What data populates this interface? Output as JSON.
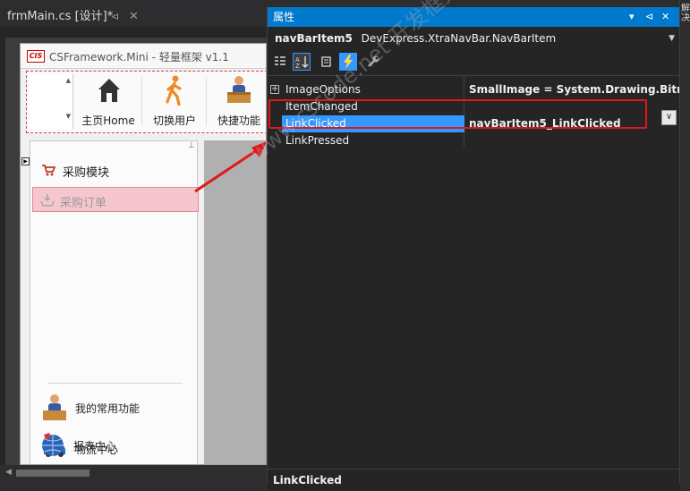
{
  "ide": {
    "doc_tab": {
      "label": "frmMain.cs [设计]*",
      "pin": "⊲",
      "close": "✕"
    }
  },
  "form": {
    "title": "CSFramework.Mini - 轻量框架 v1.1",
    "logo_text": "CIS",
    "ribbon": {
      "buttons": [
        {
          "label": "主页Home",
          "icon": "home-icon"
        },
        {
          "label": "切换用户",
          "icon": "walking-person-icon"
        },
        {
          "label": "快捷功能",
          "icon": "person-at-desk-icon"
        }
      ]
    },
    "navbar": {
      "group_label": "采购模块",
      "selected_item_label": "采购订单",
      "big_items": [
        {
          "label": "我的常用功能",
          "icon": "person-at-desk-icon"
        },
        {
          "label": "物流中心",
          "icon": "car-icon"
        },
        {
          "label": "报表中心",
          "icon": "globe-icon"
        }
      ]
    }
  },
  "properties": {
    "title": "属性",
    "title_controls": [
      "▾",
      "⊲",
      "✕"
    ],
    "object_name": "navBarItem5",
    "object_type": "DevExpress.XtraNavBar.NavBarItem",
    "toolbar": [
      "categorized",
      "alphabetical",
      "properties",
      "events",
      "property-pages"
    ],
    "rows": [
      {
        "name": "ImageOptions",
        "value": "SmallImage = System.Drawing.Bitmap",
        "expandable": true
      },
      {
        "name": "ItemChanged",
        "value": ""
      },
      {
        "name": "LinkClicked",
        "value": "navBarItem5_LinkClicked",
        "selected": true
      },
      {
        "name": "LinkPressed",
        "value": ""
      }
    ],
    "description_title": "LinkClicked"
  },
  "right_strip_text": "解决",
  "watermark": "www.cscode.net 开发框架文库",
  "colors": {
    "accent": "#007acc",
    "selection": "#3399ff",
    "highlight_box": "#e01818",
    "nav_selected": "#f6c6cf"
  }
}
